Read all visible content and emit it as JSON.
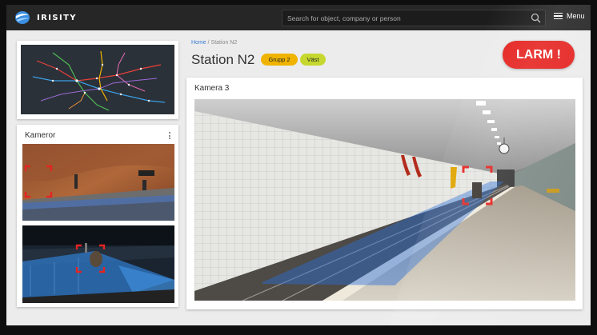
{
  "app": {
    "brand": "IRISITY"
  },
  "search": {
    "placeholder": "Search for object, company or person",
    "icon": "search-icon"
  },
  "menu": {
    "label": "Menu",
    "icon": "hamburger-icon"
  },
  "breadcrumb": {
    "home": "Home",
    "separator": "/",
    "current": "Station N2"
  },
  "page": {
    "title": "Station N2"
  },
  "badges": [
    {
      "label": "Grupp 2",
      "color": "#f0b400"
    },
    {
      "label": "Väst",
      "color": "#c6d82f"
    }
  ],
  "alarm": {
    "label": "LARM !",
    "color": "#e52421"
  },
  "cameras_panel": {
    "title": "Kameror"
  },
  "main_camera": {
    "title": "Kamera 3"
  },
  "colors": {
    "topbar": "#262626",
    "zone": "#2a6fd6",
    "detection": "#e52421"
  }
}
